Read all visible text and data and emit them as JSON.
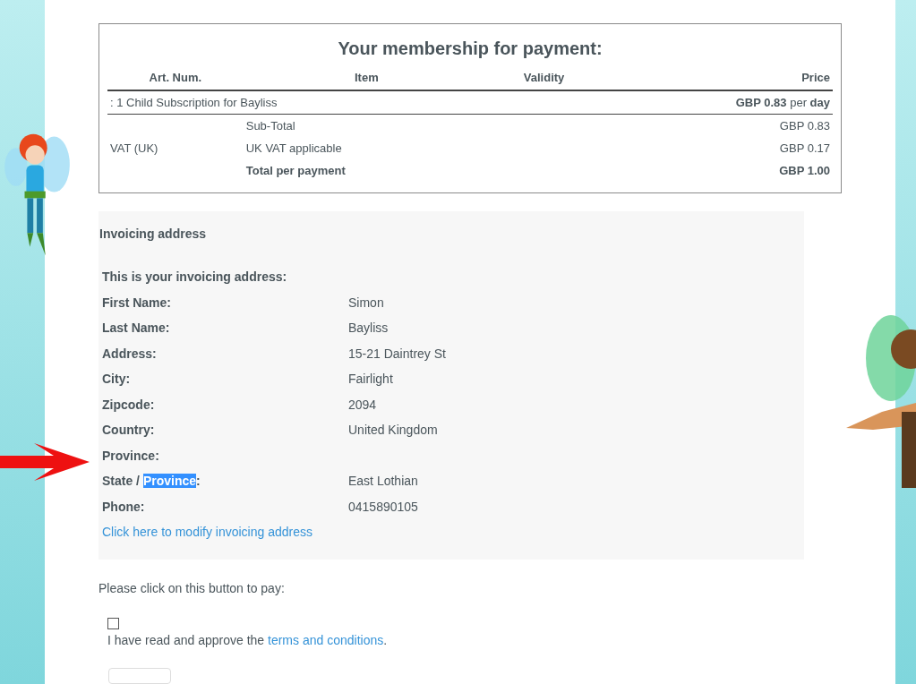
{
  "membership": {
    "title": "Your membership for payment:",
    "columns": [
      "Art. Num.",
      "Item",
      "Validity",
      "Price"
    ],
    "item": {
      "text": ": 1 Child Subscription for Bayliss",
      "price": "**GBP 0.83** per **day**"
    },
    "summary": [
      {
        "label": "Sub-Total",
        "amount": "GBP 0.83",
        "bold": false
      },
      {
        "col_1": "VAT (UK)",
        "label": "UK VAT applicable",
        "amount": "GBP 0.17",
        "bold": false
      },
      {
        "label": "Total per payment",
        "amount": "GBP 1.00",
        "bold": true
      }
    ]
  },
  "invoicing": {
    "heading": "Invoicing address",
    "intro": "This is your invoicing address:",
    "fields": [
      {
        "label": [
          {
            "text": "First Name:",
            "selected": false
          }
        ],
        "value": "Simon"
      },
      {
        "label": [
          {
            "text": "Last Name:",
            "selected": false
          }
        ],
        "value": "Bayliss"
      },
      {
        "label": [
          {
            "text": "Address:",
            "selected": false
          }
        ],
        "value": "15-21 Daintrey St"
      },
      {
        "label": [
          {
            "text": "City:",
            "selected": false
          }
        ],
        "value": "Fairlight"
      },
      {
        "label": [
          {
            "text": "Zipcode:",
            "selected": false
          }
        ],
        "value": "2094"
      },
      {
        "label": [
          {
            "text": "Country:",
            "selected": false
          }
        ],
        "value": "United Kingdom"
      },
      {
        "label": [
          {
            "text": "Province:",
            "selected": false
          }
        ]
      },
      {
        "label": [
          {
            "text": "State / ",
            "selected": false
          },
          {
            "text": "Province",
            "selected": true
          },
          {
            "text": ":",
            "selected": false
          }
        ],
        "value": "East Lothian"
      },
      {
        "label": [
          {
            "text": "Phone:",
            "selected": false
          }
        ],
        "value": "0415890105"
      }
    ],
    "modify_link": "Click here to modify invoicing address"
  },
  "payment": {
    "prompt": "Please click on this button to pay:",
    "terms_checked": false,
    "terms_text": "I have read and approve the ",
    "terms_link": "terms and conditions",
    "terms_end": "."
  }
}
